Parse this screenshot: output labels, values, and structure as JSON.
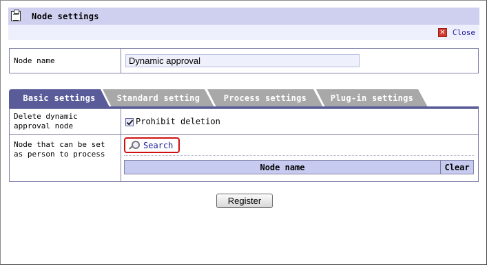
{
  "window": {
    "title": "Node settings",
    "title_icon": "clipboard-icon",
    "close_label": "Close",
    "close_icon": "close-icon"
  },
  "node": {
    "label": "Node name",
    "value": "Dynamic approval"
  },
  "tabs": [
    {
      "label": "Basic settings",
      "active": true
    },
    {
      "label": "Standard setting",
      "active": false
    },
    {
      "label": "Process settings",
      "active": false
    },
    {
      "label": "Plug-in settings",
      "active": false
    }
  ],
  "settings": {
    "delete_label": "Delete dynamic approval node",
    "prohibit_checked": true,
    "prohibit_label": "Prohibit deletion",
    "person_label": "Node that can be set as person to process",
    "search_label": "Search",
    "search_icon": "magnifier-icon",
    "grid_header": "Node name",
    "clear_label": "Clear"
  },
  "register_label": "Register",
  "colors": {
    "tab_active": "#5a5c9a",
    "tab_inactive": "#a8a8a8",
    "header_bg": "#cfd0f0",
    "highlight_border": "#d01010"
  }
}
